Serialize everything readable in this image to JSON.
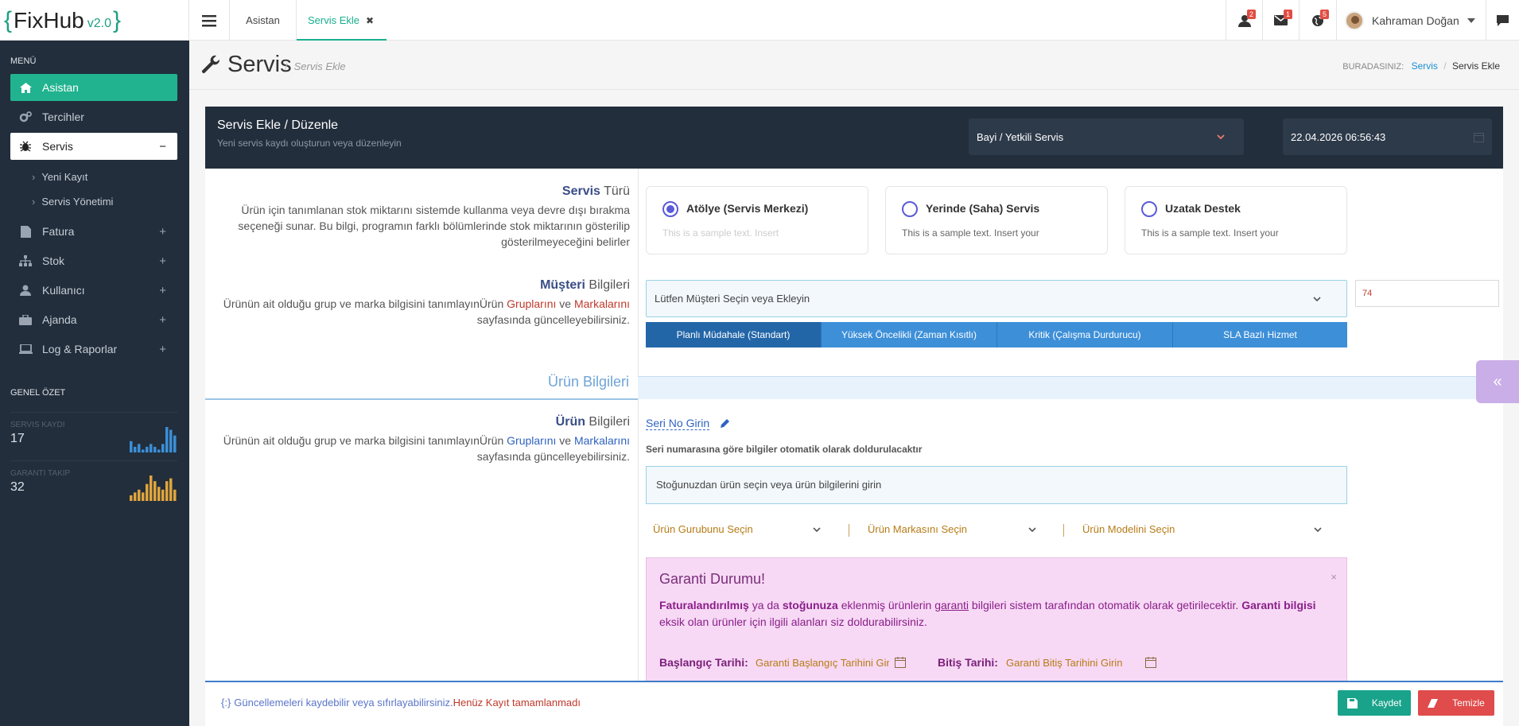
{
  "topbar": {
    "logo_name": "FixHub",
    "logo_version": "v2.0",
    "tabs": [
      {
        "label": "Asistan"
      },
      {
        "label": "Servis Ekle",
        "close": "✖"
      }
    ],
    "badges": {
      "users": "2",
      "mail": "1",
      "alerts": "5"
    },
    "user_name": "Kahraman Doğan"
  },
  "sidebar": {
    "menu_title": "MENÜ",
    "items": [
      {
        "label": "Asistan",
        "icon": "home-icon"
      },
      {
        "label": "Tercihler",
        "icon": "gears-icon"
      },
      {
        "label": "Servis",
        "icon": "bug-icon",
        "toggle": "−"
      },
      {
        "label": "Fatura",
        "icon": "document-icon",
        "toggle": "+"
      },
      {
        "label": "Stok",
        "icon": "sitemap-icon",
        "toggle": "+"
      },
      {
        "label": "Kullanıcı",
        "icon": "user-icon",
        "toggle": "+"
      },
      {
        "label": "Ajanda",
        "icon": "briefcase-icon",
        "toggle": "+"
      },
      {
        "label": "Log & Raporlar",
        "icon": "laptop-icon",
        "toggle": "+"
      }
    ],
    "sub_items": [
      {
        "label": "Yeni Kayıt"
      },
      {
        "label": "Servis Yönetimi"
      }
    ],
    "summary_title": "GENEL ÖZET",
    "stats": [
      {
        "label": "SERVIS KAYDI",
        "value": "17",
        "bars": [
          4,
          2,
          3,
          1,
          2,
          3,
          2,
          1,
          3,
          9,
          8,
          6
        ]
      },
      {
        "label": "GARANTI TAKIP",
        "value": "32",
        "bars": [
          2,
          3,
          4,
          3,
          6,
          9,
          7,
          5,
          4,
          7,
          8,
          4
        ]
      }
    ]
  },
  "page": {
    "title": "Servis",
    "subtitle": "Servis Ekle",
    "breadcrumb_label": "BURADASINIZ:",
    "breadcrumb": [
      "Servis",
      "Servis Ekle"
    ]
  },
  "card": {
    "title": "Servis Ekle / Düzenle",
    "description": "Yeni servis kaydı oluşturun veya düzenleyin",
    "dealer_select": "Bayi / Yetkili Servis",
    "datetime": "22.04.2026 06:56:43"
  },
  "service_type": {
    "heading_bold": "Servis",
    "heading_rest": " Türü",
    "desc": "Ürün için tanımlanan stok miktarını sistemde kullanma veya devre dışı bırakma seçeneği sunar. Bu bilgi, programın farklı bölümlerinde stok miktarının gösterilip gösterilmeyeceğini belirler",
    "options": [
      {
        "title": "Atölye (Servis Merkezi)",
        "desc": "This is a sample text. Insert",
        "selected": true
      },
      {
        "title": "Yerinde (Saha) Servis",
        "desc": "This is a sample text. Insert your",
        "selected": false
      },
      {
        "title": "Uzatak Destek",
        "desc": "This is a sample text. Insert your",
        "selected": false
      }
    ]
  },
  "customer": {
    "heading_bold": "Müşteri",
    "heading_rest": " Bilgileri",
    "desc_a": "Ürünün ait olduğu grup ve marka bilgisini tanımlayınÜrün ",
    "desc_link1": "Gruplarını",
    "desc_mid": " ve ",
    "desc_link2": "Markalarını",
    "desc_end": " sayfasında güncelleyebilirsiniz.",
    "select_placeholder": "Lütfen Müşteri Seçin veya Ekleyin",
    "number": "74",
    "priorities": [
      "Planlı Müdahale (Standart)",
      "Yüksek Öncelikli (Zaman Kısıtlı)",
      "Kritik (Çalışma Durdurucu)",
      "SLA Bazlı Hizmet"
    ]
  },
  "product": {
    "section_label": "Ürün Bilgileri",
    "heading_bold": "Ürün",
    "heading_rest": " Bilgileri",
    "desc_a": "Ürünün ait olduğu grup ve marka bilgisini tanımlayınÜrün ",
    "desc_link1": "Gruplarını",
    "desc_mid": " ve ",
    "desc_link2": "Markalarını",
    "desc_end": " sayfasında güncelleyebilirsiniz.",
    "serial_link": "Seri No Girin",
    "serial_hint": "Seri numarasına göre bilgiler otomatik olarak doldurulacaktır",
    "stock_placeholder": "Stoğunuzdan ürün seçin veya ürün bilgilerini girin",
    "group_select": "Ürün Gurubunu Seçin",
    "brand_select": "Ürün Markasını Seçin",
    "model_select": "Ürün Modelini Seçin"
  },
  "warranty": {
    "title": "Garanti Durumu!",
    "t1": "Faturalandırılmış",
    "t2": " ya da ",
    "t3": "stoğunuza",
    "t4": " eklenmiş ürünlerin ",
    "t5": "garanti",
    "t6": " bilgileri sistem tarafından otomatik olarak getirilecektir. ",
    "t7": "Garanti bilgisi",
    "t8": " eksik olan ürünler için ilgili alanları siz doldurabilirsiniz.",
    "close": "×",
    "start_label": "Başlangıç Tarihi:",
    "start_placeholder": "Garanti Başlangıç Tarihini Gir",
    "end_label": "Bitiş Tarihi:",
    "end_placeholder": "Garanti Bitiş Tarihini Girin"
  },
  "footer": {
    "info": "Güncellemeleri kaydebilir veya sıfırlayabilirsiniz.",
    "warning": "Henüz Kayıt tamamlanmadı",
    "save": "Kaydet",
    "clear": "Temizle"
  },
  "colors": {
    "accent": "#21b38f",
    "dark": "#222e3c",
    "blue": "#3d8fd8",
    "warning_bg": "#f7d9f5"
  }
}
